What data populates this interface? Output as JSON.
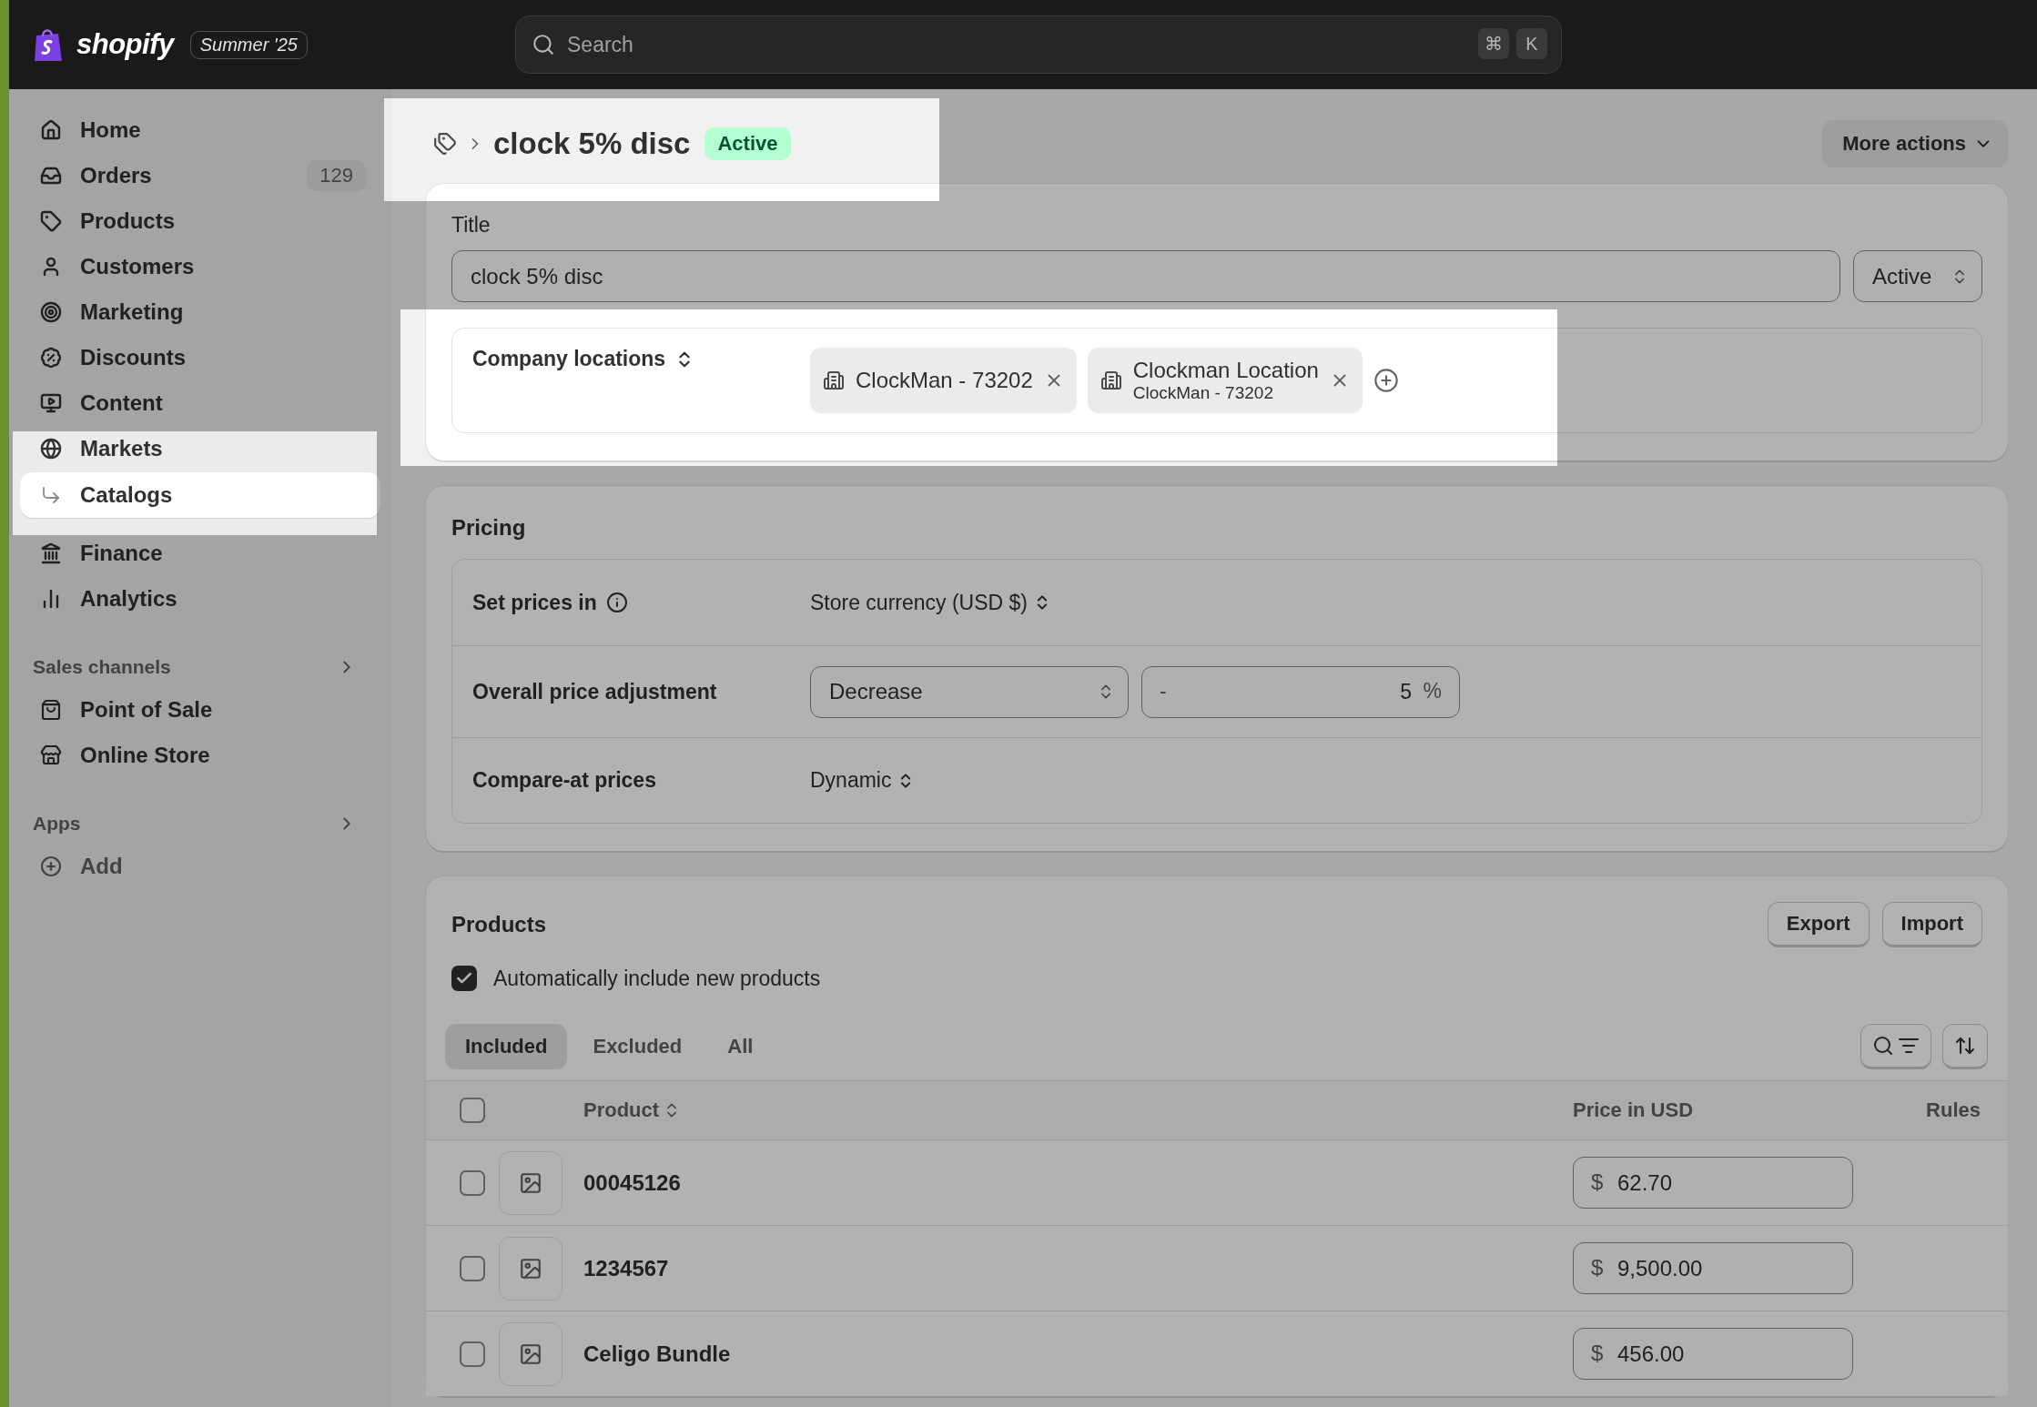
{
  "topbar": {
    "brand": "shopify",
    "edition": "Summer '25",
    "search": {
      "placeholder": "Search"
    },
    "shortcut_keys": [
      "⌘",
      "K"
    ]
  },
  "sidebar": {
    "items": [
      {
        "label": "Home",
        "selected": false
      },
      {
        "label": "Orders",
        "badge": "129",
        "selected": false
      },
      {
        "label": "Products",
        "selected": false
      },
      {
        "label": "Customers",
        "selected": false
      },
      {
        "label": "Marketing",
        "selected": false
      },
      {
        "label": "Discounts",
        "selected": false
      },
      {
        "label": "Content",
        "selected": false
      },
      {
        "label": "Markets",
        "selected": false,
        "highlighted": true,
        "children": [
          {
            "label": "Catalogs",
            "selected": true
          }
        ]
      },
      {
        "label": "Finance",
        "selected": false
      },
      {
        "label": "Analytics",
        "selected": false
      }
    ],
    "sections": [
      {
        "title": "Sales channels",
        "items": [
          {
            "label": "Point of Sale",
            "selected": false
          },
          {
            "label": "Online Store",
            "selected": false
          }
        ]
      },
      {
        "title": "Apps",
        "items": [
          {
            "label": "Add",
            "selected": false
          }
        ]
      }
    ]
  },
  "page_header": {
    "title": "clock 5% disc",
    "status": "Active",
    "highlighted": true,
    "more_actions": "More actions"
  },
  "title_card": {
    "label": "Title",
    "value": "clock 5% disc",
    "status_select": "Active"
  },
  "company_locations": {
    "label": "Company locations",
    "highlighted": true,
    "chips": [
      {
        "title": "ClockMan - 73202"
      },
      {
        "title": "Clockman Location",
        "subtitle": "ClockMan - 73202"
      }
    ]
  },
  "pricing": {
    "title": "Pricing",
    "rows": [
      {
        "kind": "select",
        "label": "Set prices in",
        "info": true,
        "value": "Store currency (USD $)"
      },
      {
        "kind": "adjustment",
        "label": "Overall price adjustment",
        "info": false,
        "direction": "Decrease",
        "prefix": "-",
        "amount": "5",
        "suffix": "%"
      },
      {
        "kind": "select",
        "label": "Compare-at prices",
        "info": false,
        "value": "Dynamic"
      }
    ]
  },
  "products": {
    "title": "Products",
    "buttons": [
      "Export",
      "Import"
    ],
    "auto_include": {
      "label": "Automatically include new products",
      "checked": true
    },
    "tabs": [
      {
        "label": "Included",
        "selected": true
      },
      {
        "label": "Excluded",
        "selected": false
      },
      {
        "label": "All",
        "selected": false
      }
    ],
    "columns": {
      "product": "Product",
      "price": "Price in USD",
      "rules": "Rules"
    },
    "select_all_checked": false,
    "rows": [
      {
        "name": "00045126",
        "currency": "$",
        "price": "62.70",
        "checked": false
      },
      {
        "name": "1234567",
        "currency": "$",
        "price": "9,500.00",
        "checked": false
      },
      {
        "name": "Celigo Bundle",
        "currency": "$",
        "price": "456.00",
        "checked": false
      }
    ]
  }
}
